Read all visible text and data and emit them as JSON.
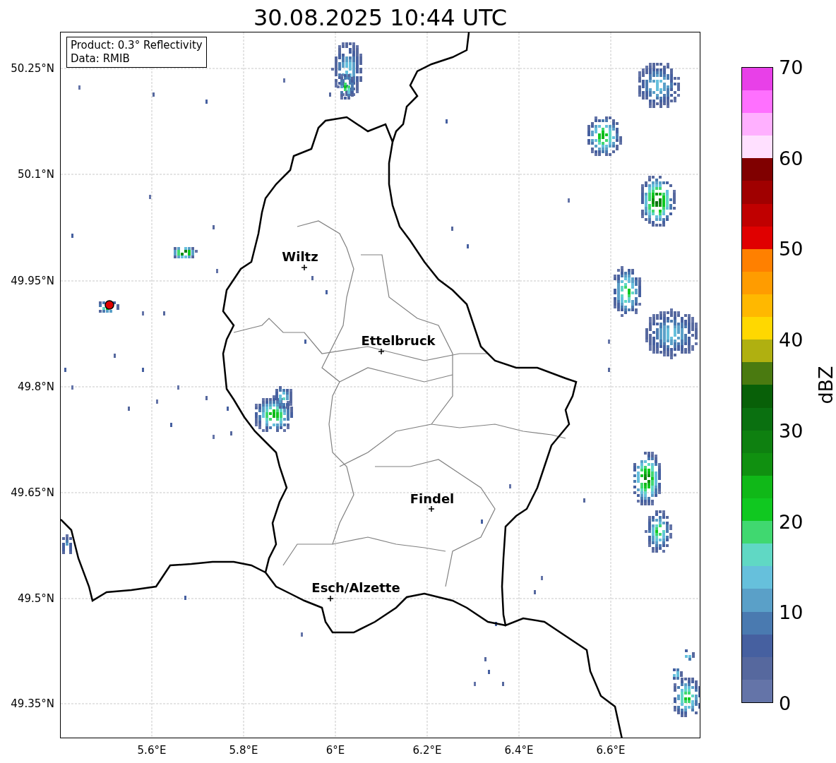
{
  "title": "30.08.2025 10:44 UTC",
  "info_box": [
    "Product: 0.3° Reflectivity",
    "Data: RMIB"
  ],
  "map": {
    "lat_ticks": [
      "50.25°N",
      "50.1°N",
      "49.95°N",
      "49.8°N",
      "49.65°N",
      "49.5°N",
      "49.35°N"
    ],
    "lon_ticks": [
      "5.6°E",
      "5.8°E",
      "6°E",
      "6.2°E",
      "6.4°E",
      "6.6°E"
    ],
    "cities": [
      {
        "name": "Wiltz"
      },
      {
        "name": "Ettelbruck"
      },
      {
        "name": "Findel"
      },
      {
        "name": "Esch/Alzette"
      }
    ]
  },
  "colorbar": {
    "label": "dBZ",
    "ticks": [
      "70",
      "60",
      "50",
      "40",
      "30",
      "20",
      "10",
      "0"
    ],
    "segments": [
      {
        "color": "#6474a8"
      },
      {
        "color": "#56689e"
      },
      {
        "color": "#4660a0"
      },
      {
        "color": "#4a7ab0"
      },
      {
        "color": "#5aa0c8"
      },
      {
        "color": "#66c0dc"
      },
      {
        "color": "#60d8c4"
      },
      {
        "color": "#40d870"
      },
      {
        "color": "#10c820"
      },
      {
        "color": "#10b818"
      },
      {
        "color": "#109010"
      },
      {
        "color": "#0e8010"
      },
      {
        "color": "#0a7010"
      },
      {
        "color": "#086008"
      },
      {
        "color": "#4a7a10"
      },
      {
        "color": "#b0b010"
      },
      {
        "color": "#ffd800"
      },
      {
        "color": "#ffb800"
      },
      {
        "color": "#ff9c00"
      },
      {
        "color": "#ff8000"
      },
      {
        "color": "#e00000"
      },
      {
        "color": "#c00000"
      },
      {
        "color": "#a00000"
      },
      {
        "color": "#800000"
      },
      {
        "color": "#ffe0ff"
      },
      {
        "color": "#ffb0ff"
      },
      {
        "color": "#ff70ff"
      },
      {
        "color": "#e840e8"
      }
    ]
  }
}
